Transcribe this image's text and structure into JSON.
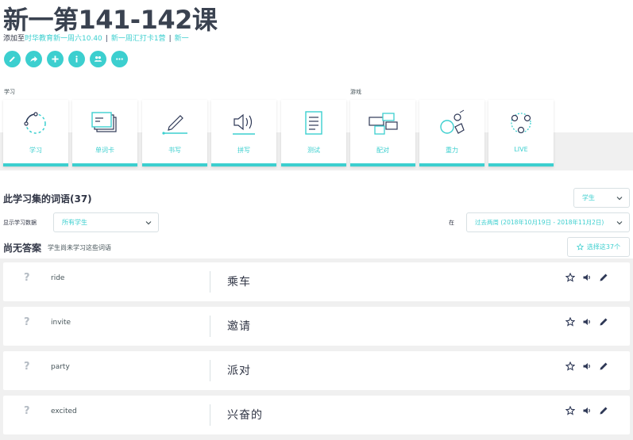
{
  "page": {
    "title": "新一第141-142课",
    "added_prefix": "添加至",
    "added_by": "时华教育新一周六10.40",
    "class_links": [
      "新一周汇打卡1营",
      "新一"
    ]
  },
  "actions": [
    {
      "name": "edit-icon",
      "label": "编辑"
    },
    {
      "name": "share-icon",
      "label": "分享"
    },
    {
      "name": "add-icon",
      "label": "添加"
    },
    {
      "name": "info-icon",
      "label": "信息"
    },
    {
      "name": "people-icon",
      "label": "成员"
    },
    {
      "name": "more-icon",
      "label": "更多"
    }
  ],
  "sections": {
    "study_label": "学习",
    "games_label": "游戏"
  },
  "modes": [
    {
      "name": "learn",
      "label": "学习",
      "icon": "learn-icon"
    },
    {
      "name": "flashcards",
      "label": "单词卡",
      "icon": "flashcards-icon"
    },
    {
      "name": "write",
      "label": "书写",
      "icon": "pencil-icon"
    },
    {
      "name": "spell",
      "label": "拼写",
      "icon": "speaker-icon"
    },
    {
      "name": "test",
      "label": "测试",
      "icon": "document-icon"
    },
    {
      "name": "match",
      "label": "配对",
      "icon": "match-icon"
    },
    {
      "name": "gravity",
      "label": "重力",
      "icon": "gravity-icon"
    },
    {
      "name": "live",
      "label": "LIVE",
      "icon": "live-icon"
    }
  ],
  "terms_section": {
    "title": "此学习集的词语(37)",
    "role_select": "学生",
    "show_progress_label": "显示学习数据",
    "student_select": "所有学生",
    "in_label": "在",
    "date_select": "过去两周 (2018年10月19日 - 2018年11月2日)",
    "no_answer_title": "尚无答案",
    "no_answer_note": "学生尚未学习这些词语",
    "select_starred": "选择这37个"
  },
  "terms": [
    {
      "word": "ride",
      "definition": "乘车"
    },
    {
      "word": "invite",
      "definition": "邀请"
    },
    {
      "word": "party",
      "definition": "派对"
    },
    {
      "word": "excited",
      "definition": "兴奋的"
    }
  ],
  "colors": {
    "accent": "#3ccfcf",
    "text": "#303545",
    "band": "#f0f0f0"
  }
}
